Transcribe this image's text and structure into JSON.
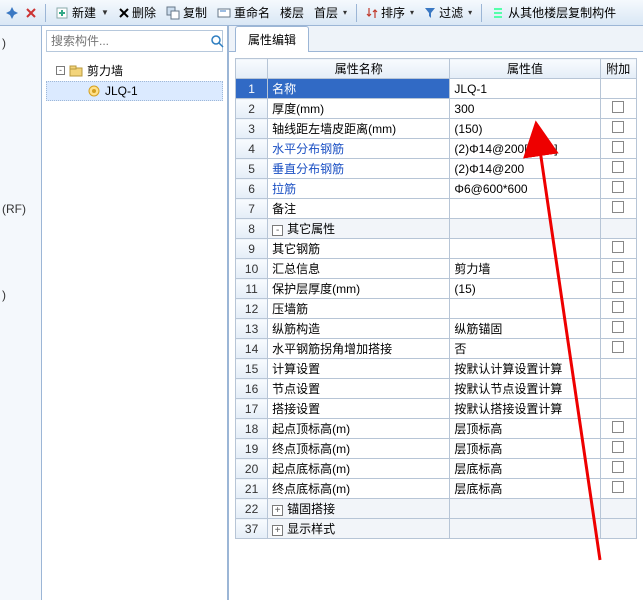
{
  "toolbar": {
    "new": "新建",
    "delete": "删除",
    "copy": "复制",
    "rename": "重命名",
    "floor": "楼层",
    "home": "首层",
    "sort": "排序",
    "filter": "过滤",
    "copyfrom": "从其他楼层复制构件"
  },
  "search": {
    "placeholder": "搜索构件..."
  },
  "tree": {
    "root": "剪力墙",
    "child": "JLQ-1"
  },
  "left": {
    "a": ")",
    "b": "(RF)",
    "c": ")"
  },
  "tab": "属性编辑",
  "headers": {
    "name": "属性名称",
    "value": "属性值",
    "add": "附加"
  },
  "rows": [
    {
      "n": "1",
      "name": "名称",
      "val": "JLQ-1",
      "sel": true
    },
    {
      "n": "2",
      "name": "厚度(mm)",
      "val": "300",
      "chk": true
    },
    {
      "n": "3",
      "name": "轴线距左墙皮距离(mm)",
      "val": "(150)",
      "chk": true
    },
    {
      "n": "4",
      "name": "水平分布钢筋",
      "val": "(2)Φ14@200[2400]",
      "chk": true,
      "link": true
    },
    {
      "n": "5",
      "name": "垂直分布钢筋",
      "val": "(2)Φ14@200",
      "chk": true,
      "link": true
    },
    {
      "n": "6",
      "name": "拉筋",
      "val": "Φ6@600*600",
      "chk": true,
      "link": true
    },
    {
      "n": "7",
      "name": "备注",
      "val": "",
      "chk": true
    },
    {
      "n": "8",
      "name": "其它属性",
      "group": true,
      "exp": "-"
    },
    {
      "n": "9",
      "name": "其它钢筋",
      "val": "",
      "chk": true,
      "indent": 2
    },
    {
      "n": "10",
      "name": "汇总信息",
      "val": "剪力墙",
      "chk": true,
      "indent": 2
    },
    {
      "n": "11",
      "name": "保护层厚度(mm)",
      "val": "(15)",
      "chk": true,
      "indent": 2
    },
    {
      "n": "12",
      "name": "压墙筋",
      "val": "",
      "chk": true,
      "indent": 2
    },
    {
      "n": "13",
      "name": "纵筋构造",
      "val": "纵筋锚固",
      "chk": true,
      "indent": 2
    },
    {
      "n": "14",
      "name": "水平钢筋拐角增加搭接",
      "val": "否",
      "chk": true,
      "indent": 2
    },
    {
      "n": "15",
      "name": "计算设置",
      "val": "按默认计算设置计算",
      "indent": 2
    },
    {
      "n": "16",
      "name": "节点设置",
      "val": "按默认节点设置计算",
      "indent": 2
    },
    {
      "n": "17",
      "name": "搭接设置",
      "val": "按默认搭接设置计算",
      "indent": 2
    },
    {
      "n": "18",
      "name": "起点顶标高(m)",
      "val": "层顶标高",
      "chk": true,
      "indent": 2
    },
    {
      "n": "19",
      "name": "终点顶标高(m)",
      "val": "层顶标高",
      "chk": true,
      "indent": 2
    },
    {
      "n": "20",
      "name": "起点底标高(m)",
      "val": "层底标高",
      "chk": true,
      "indent": 2
    },
    {
      "n": "21",
      "name": "终点底标高(m)",
      "val": "层底标高",
      "chk": true,
      "indent": 2
    },
    {
      "n": "22",
      "name": "锚固搭接",
      "group": true,
      "exp": "+"
    },
    {
      "n": "37",
      "name": "显示样式",
      "group": true,
      "exp": "+"
    }
  ]
}
